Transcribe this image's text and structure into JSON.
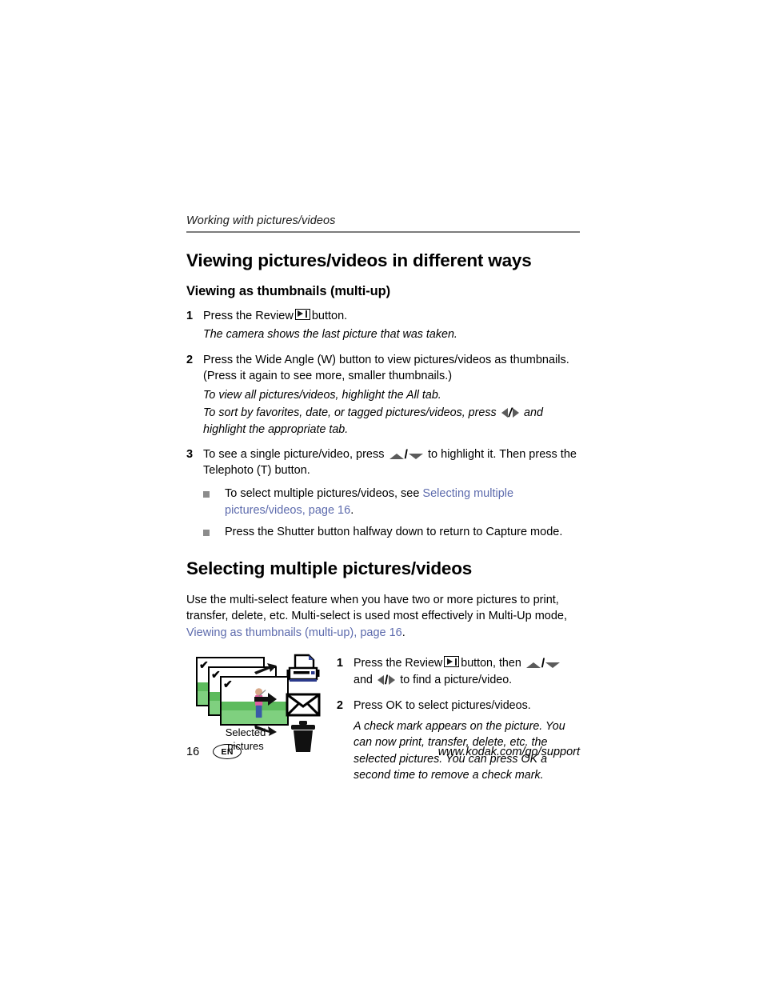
{
  "header": {
    "running_title": "Working with pictures/videos"
  },
  "section1": {
    "title": "Viewing pictures/videos in different ways",
    "subtitle": "Viewing as thumbnails (multi-up)",
    "step1": {
      "num": "1",
      "text_before": "Press the Review",
      "text_after": "button."
    },
    "note1": "The camera shows the last picture that was taken.",
    "step2": {
      "num": "2",
      "text": "Press the Wide Angle (W) button to view pictures/videos as thumbnails. (Press it again to see more, smaller thumbnails.)"
    },
    "note2a": "To view all pictures/videos, highlight the All tab.",
    "note2b_before": "To sort by favorites, date, or tagged pictures/videos, press",
    "note2b_after": "and highlight the appropriate tab.",
    "step3": {
      "num": "3",
      "text_before": "To see a single picture/video, press",
      "text_after": "to highlight it. Then press the Telephoto (T) button."
    },
    "bullet1_before": "To select multiple pictures/videos, see ",
    "bullet1_link": "Selecting multiple pictures/videos, page 16",
    "bullet1_after": ".",
    "bullet2": "Press the Shutter button halfway down to return to Capture mode."
  },
  "section2": {
    "title": "Selecting multiple pictures/videos",
    "para_before": "Use the multi-select feature when you have two or more pictures to print, transfer, delete, etc. Multi-select is used most effectively in Multi-Up mode, ",
    "para_link": "Viewing as thumbnails (multi-up), page 16",
    "para_after": ".",
    "illustration": {
      "caption_line1": "Selected",
      "caption_line2": "pictures",
      "icons": [
        "printer-icon",
        "envelope-icon",
        "trash-icon"
      ],
      "check_mark": "✔"
    },
    "step1": {
      "num": "1",
      "text_before": "Press the Review",
      "text_mid": "button, then",
      "text_and": "and",
      "text_after": "to find a picture/video."
    },
    "step2": {
      "num": "2",
      "text": "Press OK to select pictures/videos."
    },
    "note": "A check mark appears on the picture. You can now print, transfer, delete, etc. the selected pictures. You can press OK a second time to remove a check mark."
  },
  "footer": {
    "page_number": "16",
    "language_badge": "EN",
    "url": "www.kodak.com/go/support"
  },
  "colors": {
    "link": "#5d6bad",
    "rule": "#7d7d7d",
    "bullet": "#8c8c8c",
    "glyph_gray": "#5b5b5b",
    "grass": "#5dbb5d",
    "printer_blue": "#2b3a8c"
  }
}
